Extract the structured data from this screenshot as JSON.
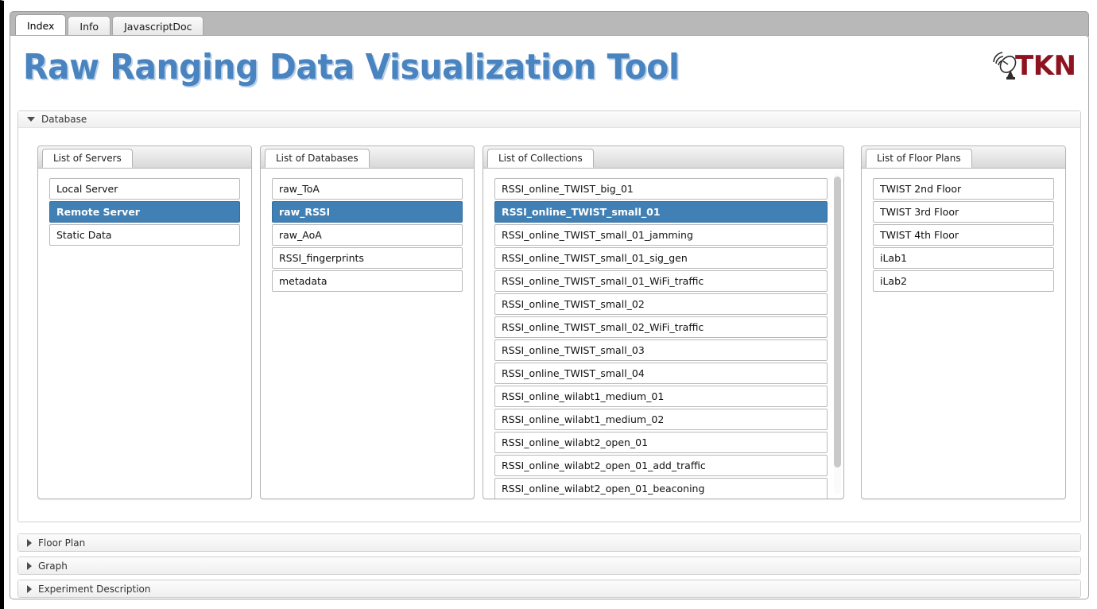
{
  "tabs": [
    {
      "label": "Index",
      "active": true
    },
    {
      "label": "Info",
      "active": false
    },
    {
      "label": "JavascriptDoc",
      "active": false
    }
  ],
  "header": {
    "title": "Raw Ranging Data Visualization Tool",
    "title_color": "#4a84c0",
    "logo_text": "TKN",
    "logo_color": "#8e1220",
    "logo_icon": "satellite-dish-icon"
  },
  "accent_color": "#4180b5",
  "sections": [
    {
      "id": "database",
      "label": "Database",
      "expanded": true,
      "icon": "triangle-down-icon"
    },
    {
      "id": "floorplan",
      "label": "Floor Plan",
      "expanded": false,
      "icon": "triangle-right-icon"
    },
    {
      "id": "graph",
      "label": "Graph",
      "expanded": false,
      "icon": "triangle-right-icon"
    },
    {
      "id": "expdesc",
      "label": "Experiment Description",
      "expanded": false,
      "icon": "triangle-right-icon"
    }
  ],
  "panels": {
    "servers": {
      "tab_label": "List of Servers",
      "items": [
        {
          "label": "Local Server",
          "selected": false
        },
        {
          "label": "Remote Server",
          "selected": true
        },
        {
          "label": "Static Data",
          "selected": false
        }
      ]
    },
    "databases": {
      "tab_label": "List of Databases",
      "items": [
        {
          "label": "raw_ToA",
          "selected": false
        },
        {
          "label": "raw_RSSI",
          "selected": true
        },
        {
          "label": "raw_AoA",
          "selected": false
        },
        {
          "label": "RSSI_fingerprints",
          "selected": false
        },
        {
          "label": "metadata",
          "selected": false
        }
      ]
    },
    "collections": {
      "tab_label": "List of Collections",
      "scrollbar": true,
      "items": [
        {
          "label": "RSSI_online_TWIST_big_01",
          "selected": false
        },
        {
          "label": "RSSI_online_TWIST_small_01",
          "selected": true
        },
        {
          "label": "RSSI_online_TWIST_small_01_jamming",
          "selected": false
        },
        {
          "label": "RSSI_online_TWIST_small_01_sig_gen",
          "selected": false
        },
        {
          "label": "RSSI_online_TWIST_small_01_WiFi_traffic",
          "selected": false
        },
        {
          "label": "RSSI_online_TWIST_small_02",
          "selected": false
        },
        {
          "label": "RSSI_online_TWIST_small_02_WiFi_traffic",
          "selected": false
        },
        {
          "label": "RSSI_online_TWIST_small_03",
          "selected": false
        },
        {
          "label": "RSSI_online_TWIST_small_04",
          "selected": false
        },
        {
          "label": "RSSI_online_wilabt1_medium_01",
          "selected": false
        },
        {
          "label": "RSSI_online_wilabt1_medium_02",
          "selected": false
        },
        {
          "label": "RSSI_online_wilabt2_open_01",
          "selected": false
        },
        {
          "label": "RSSI_online_wilabt2_open_01_add_traffic",
          "selected": false
        },
        {
          "label": "RSSI_online_wilabt2_open_01_beaconing",
          "selected": false
        }
      ]
    },
    "floorplans": {
      "tab_label": "List of Floor Plans",
      "items": [
        {
          "label": "TWIST 2nd Floor",
          "selected": false
        },
        {
          "label": "TWIST 3rd Floor",
          "selected": false
        },
        {
          "label": "TWIST 4th Floor",
          "selected": false
        },
        {
          "label": "iLab1",
          "selected": false
        },
        {
          "label": "iLab2",
          "selected": false
        }
      ]
    }
  }
}
